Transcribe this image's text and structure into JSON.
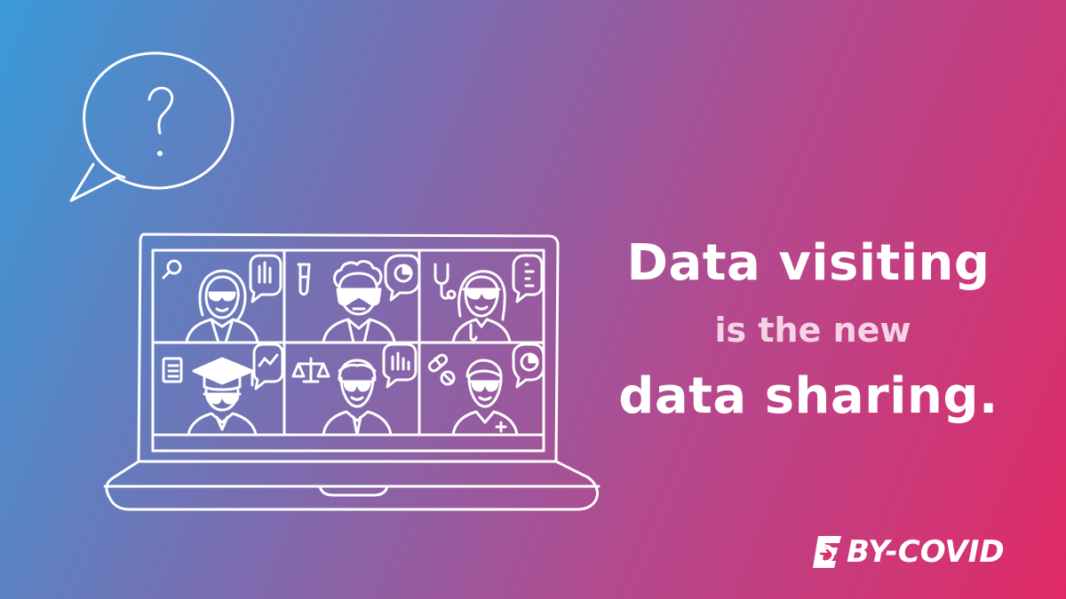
{
  "headline": {
    "line1": "Data visiting",
    "line2": "is the new",
    "line3": "data sharing."
  },
  "brand": {
    "logo_text": "BY-COVID"
  },
  "icons": {
    "speech_bubble": "question-speech-bubble-icon",
    "laptop": "laptop-video-call-icon"
  },
  "colors": {
    "gradient_start": "#3a9ad8",
    "gradient_end": "#e02a66",
    "text": "#ffffff",
    "text_muted": "#f6d3e4"
  }
}
